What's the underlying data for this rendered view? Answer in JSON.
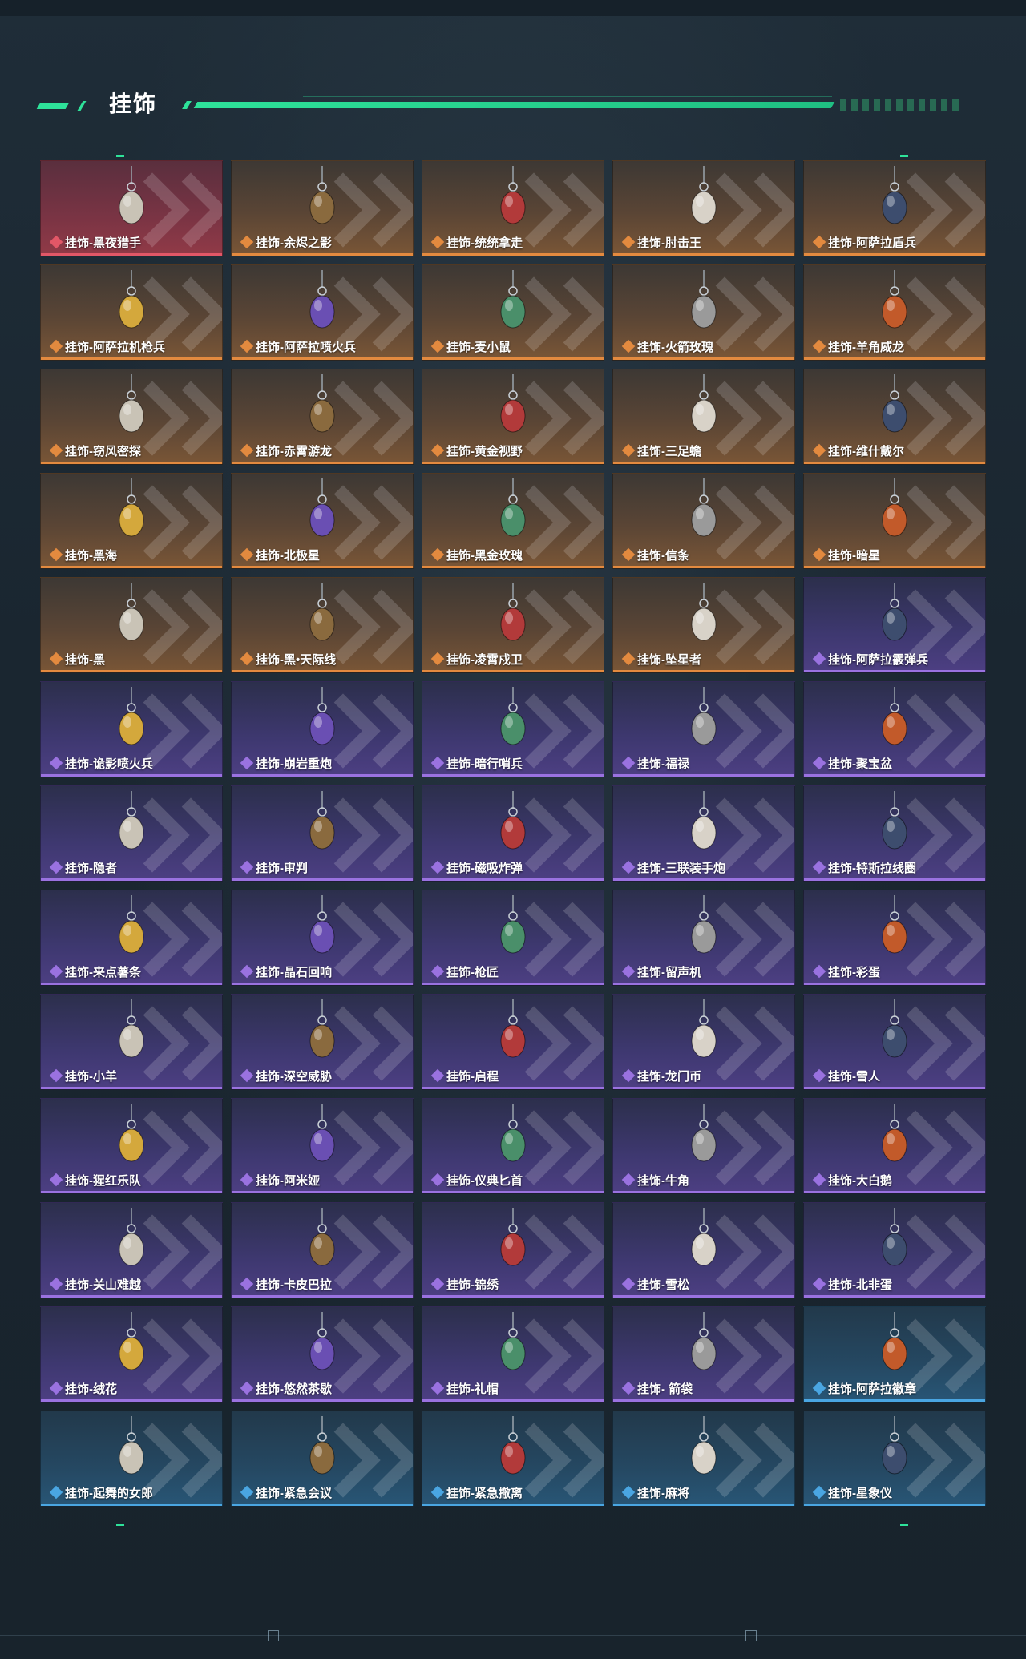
{
  "header": {
    "title": "挂饰"
  },
  "colors": {
    "accent": "#2ee29a",
    "rarity_red": "#e25767",
    "rarity_gold": "#e38a3f",
    "rarity_purple": "#9a72e0",
    "rarity_blue": "#4aa6e2"
  },
  "items": [
    {
      "name": "挂饰-黑夜猎手",
      "rarity": "red",
      "icon": "white-bird-charm-icon"
    },
    {
      "name": "挂饰-余烬之影",
      "rarity": "gold",
      "icon": "dark-warrior-charm-icon"
    },
    {
      "name": "挂饰-统统拿走",
      "rarity": "gold",
      "icon": "gasmask-soldier-charm-icon"
    },
    {
      "name": "挂饰-肘击王",
      "rarity": "gold",
      "icon": "red-duck-charm-icon"
    },
    {
      "name": "挂饰-阿萨拉盾兵",
      "rarity": "gold",
      "icon": "shield-soldier-charm-icon"
    },
    {
      "name": "挂饰-阿萨拉机枪兵",
      "rarity": "gold",
      "icon": "machinegun-soldier-charm-icon"
    },
    {
      "name": "挂饰-阿萨拉喷火兵",
      "rarity": "gold",
      "icon": "flamethrower-soldier-charm-icon"
    },
    {
      "name": "挂饰-麦小鼠",
      "rarity": "gold",
      "icon": "mouse-charm-icon"
    },
    {
      "name": "挂饰-火箭玫瑰",
      "rarity": "gold",
      "icon": "rocket-rose-charm-icon"
    },
    {
      "name": "挂饰-羊角威龙",
      "rarity": "gold",
      "icon": "ram-dragon-charm-icon"
    },
    {
      "name": "挂饰-窃风密探",
      "rarity": "gold",
      "icon": "rabbit-spy-charm-icon"
    },
    {
      "name": "挂饰-赤霄游龙",
      "rarity": "gold",
      "icon": "yellow-dragon-charm-icon"
    },
    {
      "name": "挂饰-黄金视野",
      "rarity": "gold",
      "icon": "golden-vision-charm-icon"
    },
    {
      "name": "挂饰-三足蟾",
      "rarity": "gold",
      "icon": "golden-toad-charm-icon"
    },
    {
      "name": "挂饰-维什戴尔",
      "rarity": "gold",
      "icon": "tag-charm-icon"
    },
    {
      "name": "挂饰-黑海",
      "rarity": "gold",
      "icon": "anchor-charm-icon"
    },
    {
      "name": "挂饰-北极星",
      "rarity": "gold",
      "icon": "blue-star-charm-icon"
    },
    {
      "name": "挂饰-黑金玫瑰",
      "rarity": "gold",
      "icon": "black-rose-charm-icon"
    },
    {
      "name": "挂饰-信条",
      "rarity": "gold",
      "icon": "knife-charm-icon"
    },
    {
      "name": "挂饰-暗星",
      "rarity": "gold",
      "icon": "crane-charm-icon"
    },
    {
      "name": "挂饰-黑",
      "rarity": "gold",
      "icon": "red-tag-charm-icon"
    },
    {
      "name": "挂饰-黑•天际线",
      "rarity": "gold",
      "icon": "helmet-charm-icon"
    },
    {
      "name": "挂饰-凌霄戍卫",
      "rarity": "gold",
      "icon": "white-eagle-charm-icon"
    },
    {
      "name": "挂饰-坠星者",
      "rarity": "gold",
      "icon": "purple-crystal-charm-icon"
    },
    {
      "name": "挂饰-阿萨拉霰弹兵",
      "rarity": "purple",
      "icon": "shotgun-soldier-charm-icon"
    },
    {
      "name": "挂饰-诡影喷火兵",
      "rarity": "purple",
      "icon": "shadow-flamer-charm-icon"
    },
    {
      "name": "挂饰-崩岩重炮",
      "rarity": "purple",
      "icon": "heavy-gunner-charm-icon"
    },
    {
      "name": "挂饰-暗行哨兵",
      "rarity": "purple",
      "icon": "sentry-charm-icon"
    },
    {
      "name": "挂饰-福禄",
      "rarity": "purple",
      "icon": "gourd-charm-icon"
    },
    {
      "name": "挂饰-聚宝盆",
      "rarity": "purple",
      "icon": "treasure-bowl-charm-icon"
    },
    {
      "name": "挂饰-隐者",
      "rarity": "purple",
      "icon": "hermit-card-charm-icon"
    },
    {
      "name": "挂饰-审判",
      "rarity": "purple",
      "icon": "judgement-card-charm-icon"
    },
    {
      "name": "挂饰-磁吸炸弹",
      "rarity": "purple",
      "icon": "magnetic-bomb-charm-icon"
    },
    {
      "name": "挂饰-三联装手炮",
      "rarity": "purple",
      "icon": "hand-cannon-charm-icon"
    },
    {
      "name": "挂饰-特斯拉线圈",
      "rarity": "purple",
      "icon": "tesla-coil-charm-icon"
    },
    {
      "name": "挂饰-来点薯条",
      "rarity": "purple",
      "icon": "fries-charm-icon"
    },
    {
      "name": "挂饰-晶石回响",
      "rarity": "purple",
      "icon": "crystal-charm-icon"
    },
    {
      "name": "挂饰-枪匠",
      "rarity": "purple",
      "icon": "gunsmith-crate-charm-icon"
    },
    {
      "name": "挂饰-留声机",
      "rarity": "purple",
      "icon": "gramophone-charm-icon"
    },
    {
      "name": "挂饰-彩蛋",
      "rarity": "purple",
      "icon": "green-egg-charm-icon"
    },
    {
      "name": "挂饰-小羊",
      "rarity": "purple",
      "icon": "lamb-charm-icon"
    },
    {
      "name": "挂饰-深空威胁",
      "rarity": "purple",
      "icon": "radio-charm-icon"
    },
    {
      "name": "挂饰-启程",
      "rarity": "purple",
      "icon": "wreath-charm-icon"
    },
    {
      "name": "挂饰-龙门币",
      "rarity": "purple",
      "icon": "coin-card-charm-icon"
    },
    {
      "name": "挂饰-雪人",
      "rarity": "purple",
      "icon": "snowman-charm-icon"
    },
    {
      "name": "挂饰-猩红乐队",
      "rarity": "purple",
      "icon": "band-charm-icon"
    },
    {
      "name": "挂饰-阿米娅",
      "rarity": "purple",
      "icon": "bunny-ears-charm-icon"
    },
    {
      "name": "挂饰-仪典匕首",
      "rarity": "purple",
      "icon": "dagger-charm-icon"
    },
    {
      "name": "挂饰-牛角",
      "rarity": "purple",
      "icon": "bull-horn-charm-icon"
    },
    {
      "name": "挂饰-大白鹅",
      "rarity": "purple",
      "icon": "goose-charm-icon"
    },
    {
      "name": "挂饰-关山难越",
      "rarity": "purple",
      "icon": "yellow-scroll-charm-icon"
    },
    {
      "name": "挂饰-卡皮巴拉",
      "rarity": "purple",
      "icon": "capybara-charm-icon"
    },
    {
      "name": "挂饰-锦绣",
      "rarity": "purple",
      "icon": "butterfly-charm-icon"
    },
    {
      "name": "挂饰-雪松",
      "rarity": "purple",
      "icon": "pine-tree-charm-icon"
    },
    {
      "name": "挂饰-北非蛋",
      "rarity": "purple",
      "icon": "egg-dish-charm-icon"
    },
    {
      "name": "挂饰-绒花",
      "rarity": "purple",
      "icon": "red-flower-charm-icon"
    },
    {
      "name": "挂饰-悠然茶歇",
      "rarity": "purple",
      "icon": "cupcake-charm-icon"
    },
    {
      "name": "挂饰-礼帽",
      "rarity": "purple",
      "icon": "hat-charm-icon"
    },
    {
      "name": "挂饰- 箭袋",
      "rarity": "purple",
      "icon": "quiver-charm-icon"
    },
    {
      "name": "挂饰-阿萨拉徽章",
      "rarity": "blue",
      "icon": "badge-charm-icon"
    },
    {
      "name": "挂饰-起舞的女郎",
      "rarity": "blue",
      "icon": "dancer-charm-icon"
    },
    {
      "name": "挂饰-紧急会议",
      "rarity": "blue",
      "icon": "emergency-meeting-charm-icon"
    },
    {
      "name": "挂饰-紧急撤离",
      "rarity": "blue",
      "icon": "evac-tag-charm-icon"
    },
    {
      "name": "挂饰-麻将",
      "rarity": "blue",
      "icon": "mahjong-charm-icon"
    },
    {
      "name": "挂饰-星象仪",
      "rarity": "blue",
      "icon": "armillary-charm-icon"
    }
  ]
}
